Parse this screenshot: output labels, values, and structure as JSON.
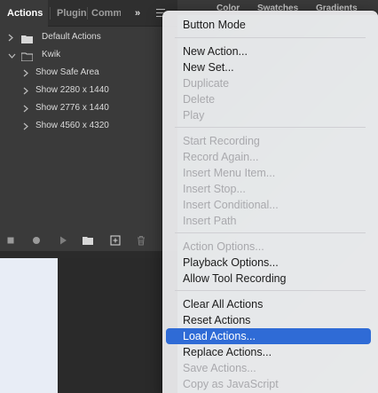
{
  "actions_panel": {
    "tabs": [
      {
        "label": "Actions",
        "active": true
      },
      {
        "label": "Plugins",
        "active": false
      },
      {
        "label": "Comm",
        "active": false
      }
    ],
    "overflow_label": "»",
    "rows": [
      {
        "label": "Default Actions",
        "type": "set",
        "expanded": false
      },
      {
        "label": "Kwik",
        "type": "set",
        "expanded": true
      },
      {
        "label": "Show Safe Area",
        "type": "action"
      },
      {
        "label": "Show 2280 x 1440",
        "type": "action"
      },
      {
        "label": "Show 2776 x 1440",
        "type": "action"
      },
      {
        "label": "Show 4560 x 4320",
        "type": "action"
      }
    ],
    "toolbar_icons": [
      "stop-icon",
      "record-icon",
      "play-icon",
      "folder-icon",
      "new-action-icon",
      "trash-icon"
    ]
  },
  "right_panel": {
    "tabs": [
      {
        "label": "Color"
      },
      {
        "label": "Swatches"
      },
      {
        "label": "Gradients"
      }
    ]
  },
  "menu": {
    "items": [
      {
        "label": "Button Mode",
        "disabled": false
      },
      {
        "separator": true
      },
      {
        "label": "New Action...",
        "disabled": false
      },
      {
        "label": "New Set...",
        "disabled": false
      },
      {
        "label": "Duplicate",
        "disabled": true
      },
      {
        "label": "Delete",
        "disabled": true
      },
      {
        "label": "Play",
        "disabled": true
      },
      {
        "separator": true
      },
      {
        "label": "Start Recording",
        "disabled": true
      },
      {
        "label": "Record Again...",
        "disabled": true
      },
      {
        "label": "Insert Menu Item...",
        "disabled": true
      },
      {
        "label": "Insert Stop...",
        "disabled": true
      },
      {
        "label": "Insert Conditional...",
        "disabled": true
      },
      {
        "label": "Insert Path",
        "disabled": true
      },
      {
        "separator": true
      },
      {
        "label": "Action Options...",
        "disabled": true
      },
      {
        "label": "Playback Options...",
        "disabled": false
      },
      {
        "label": "Allow Tool Recording",
        "disabled": false
      },
      {
        "separator": true
      },
      {
        "label": "Clear All Actions",
        "disabled": false
      },
      {
        "label": "Reset Actions",
        "disabled": false
      },
      {
        "label": "Load Actions...",
        "disabled": false,
        "highlighted": true
      },
      {
        "label": "Replace Actions...",
        "disabled": false
      },
      {
        "label": "Save Actions...",
        "disabled": true
      },
      {
        "label": "Copy as JavaScript",
        "disabled": true
      }
    ]
  },
  "colors": {
    "highlight": "#2f6bd6",
    "panel_bg": "#3a3a3a",
    "menu_bg": "#e8e8ea",
    "disabled_text": "#a9a9ad"
  }
}
